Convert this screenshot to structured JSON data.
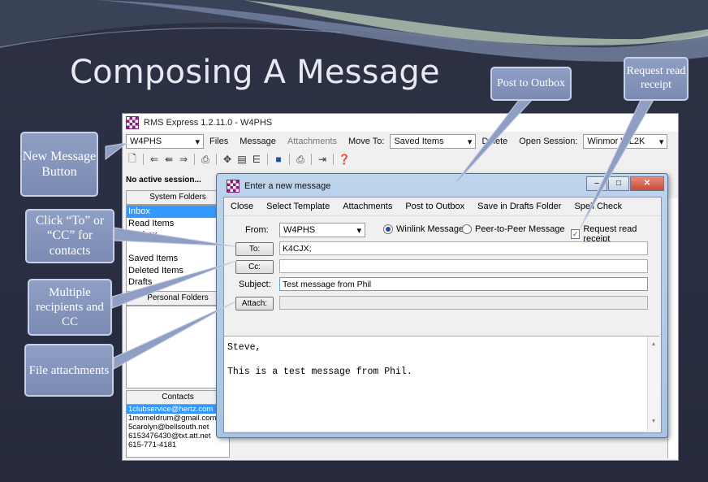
{
  "slide": {
    "title": "Composing A Message"
  },
  "app": {
    "window_title": "RMS Express 1.2.11.0 - W4PHS",
    "callsign_combo": "W4PHS",
    "menu": [
      "Files",
      "Message",
      "Attachments"
    ],
    "move_to_label": "Move To:",
    "move_to_value": "Saved Items",
    "delete_label": "Delete",
    "open_session_label": "Open Session:",
    "open_session_value": "Winmor WL2K",
    "status_text": "No active session...",
    "system_folders_header": "System Folders",
    "system_folders": [
      "Inbox",
      "Read Items",
      "Outbox",
      "",
      "Saved Items",
      "Deleted Items",
      "Drafts"
    ],
    "personal_folders_header": "Personal Folders",
    "contacts_header": "Contacts",
    "contacts": [
      "1clubservice@hertz.com",
      "1momeldrum@gmail.com",
      "5carolyn@bellsouth.net",
      "6153476430@txt.att.net",
      "615-771-4181"
    ]
  },
  "dialog": {
    "title": "Enter a new message",
    "menu": [
      "Close",
      "Select Template",
      "Attachments",
      "Post to Outbox",
      "Save in Drafts Folder",
      "Spell Check"
    ],
    "from_label": "From:",
    "from_value": "W4PHS",
    "winlink_label": "Winlink Message",
    "p2p_label": "Peer-to-Peer Message",
    "read_receipt_label": "Request read receipt",
    "to_button": "To:",
    "to_value": "K4CJX;",
    "cc_button": "Cc:",
    "cc_value": "",
    "subject_label": "Subject:",
    "subject_value": "Test message from Phil",
    "attach_button": "Attach:",
    "body_line1": "Steve,",
    "body_line2": "This is a test message from Phil."
  },
  "callouts": {
    "new_message": "New Message Button",
    "click_to": "Click “To” or “CC” for contacts",
    "multiple": "Multiple recipients and CC",
    "file_attach": "File attachments",
    "post_outbox": "Post to Outbox",
    "read_receipt": "Request read receipt"
  }
}
